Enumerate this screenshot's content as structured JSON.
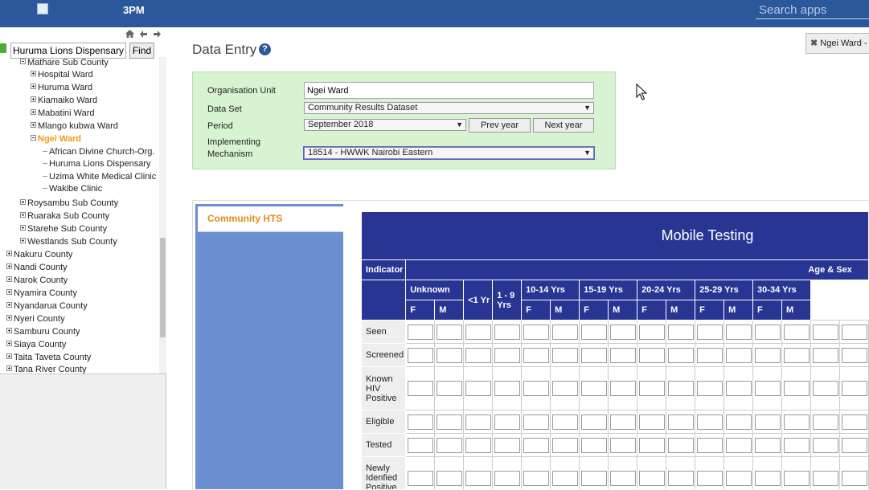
{
  "header": {
    "app_title": "3PM",
    "search_placeholder": "Search apps"
  },
  "left_panel": {
    "search_value": "Huruma Lions Dispensary",
    "find_label": "Find",
    "tree": [
      {
        "label": "Mathare Sub County",
        "level": 2,
        "state": "minus"
      },
      {
        "label": "Hospital Ward",
        "level": 3,
        "state": "plus"
      },
      {
        "label": "Huruma Ward",
        "level": 3,
        "state": "plus"
      },
      {
        "label": "Kiamaiko Ward",
        "level": 3,
        "state": "plus"
      },
      {
        "label": "Mabatini Ward",
        "level": 3,
        "state": "plus"
      },
      {
        "label": "Mlango kubwa Ward",
        "level": 3,
        "state": "plus"
      },
      {
        "label": "Ngei Ward",
        "level": 3,
        "state": "minus",
        "selected": true
      },
      {
        "label": "African Divine Church-Org.",
        "level": 4,
        "state": "leaf"
      },
      {
        "label": "Huruma Lions Dispensary",
        "level": 4,
        "state": "leaf"
      },
      {
        "label": "Uzima White Medical Clinic",
        "level": 4,
        "state": "leaf"
      },
      {
        "label": "Wakibe Clinic",
        "level": 4,
        "state": "leaf"
      },
      {
        "label": "Roysambu Sub County",
        "level": 2,
        "state": "plus"
      },
      {
        "label": "Ruaraka Sub County",
        "level": 2,
        "state": "plus"
      },
      {
        "label": "Starehe Sub County",
        "level": 2,
        "state": "plus"
      },
      {
        "label": "Westlands Sub County",
        "level": 2,
        "state": "plus"
      },
      {
        "label": "Nakuru County",
        "level": 1,
        "state": "plus"
      },
      {
        "label": "Nandi County",
        "level": 1,
        "state": "plus"
      },
      {
        "label": "Narok County",
        "level": 1,
        "state": "plus"
      },
      {
        "label": "Nyamira County",
        "level": 1,
        "state": "plus"
      },
      {
        "label": "Nyandarua County",
        "level": 1,
        "state": "plus"
      },
      {
        "label": "Nyeri County",
        "level": 1,
        "state": "plus"
      },
      {
        "label": "Samburu County",
        "level": 1,
        "state": "plus"
      },
      {
        "label": "Siaya County",
        "level": 1,
        "state": "plus"
      },
      {
        "label": "Taita Taveta County",
        "level": 1,
        "state": "plus"
      },
      {
        "label": "Tana River County",
        "level": 1,
        "state": "plus"
      }
    ]
  },
  "main": {
    "page_title": "Data Entry",
    "help_icon": "?",
    "ou_tab_label": "Ngei Ward - ",
    "ou_tab_close": "✖",
    "form": {
      "org_unit_label": "Organisation Unit",
      "org_unit_value": "Ngei Ward",
      "dataset_label": "Data Set",
      "dataset_value": "Community Results Dataset",
      "period_label": "Period",
      "period_value": "September 2018",
      "prev_year": "Prev year",
      "next_year": "Next year",
      "mechanism_label_1": "Implementing",
      "mechanism_label_2": "Mechanism",
      "mechanism_value": "18514 - HWWK Nairobi Eastern"
    },
    "section_tab": "Community HTS",
    "table": {
      "title": "Mobile Testing",
      "indicator_header": "Indicator",
      "age_sex_header": "Age & Sex",
      "age_groups": [
        "Unknown",
        "<1 Yr",
        "1 - 9 Yrs",
        "10-14 Yrs",
        "15-19 Yrs",
        "20-24 Yrs",
        "25-29 Yrs",
        "30-34 Yrs"
      ],
      "sex": [
        "F",
        "M"
      ],
      "rows": [
        "Seen",
        "Screened",
        "Known HIV Positive",
        "Eligible",
        "Tested",
        "Newly Idenfied Positive"
      ]
    }
  }
}
